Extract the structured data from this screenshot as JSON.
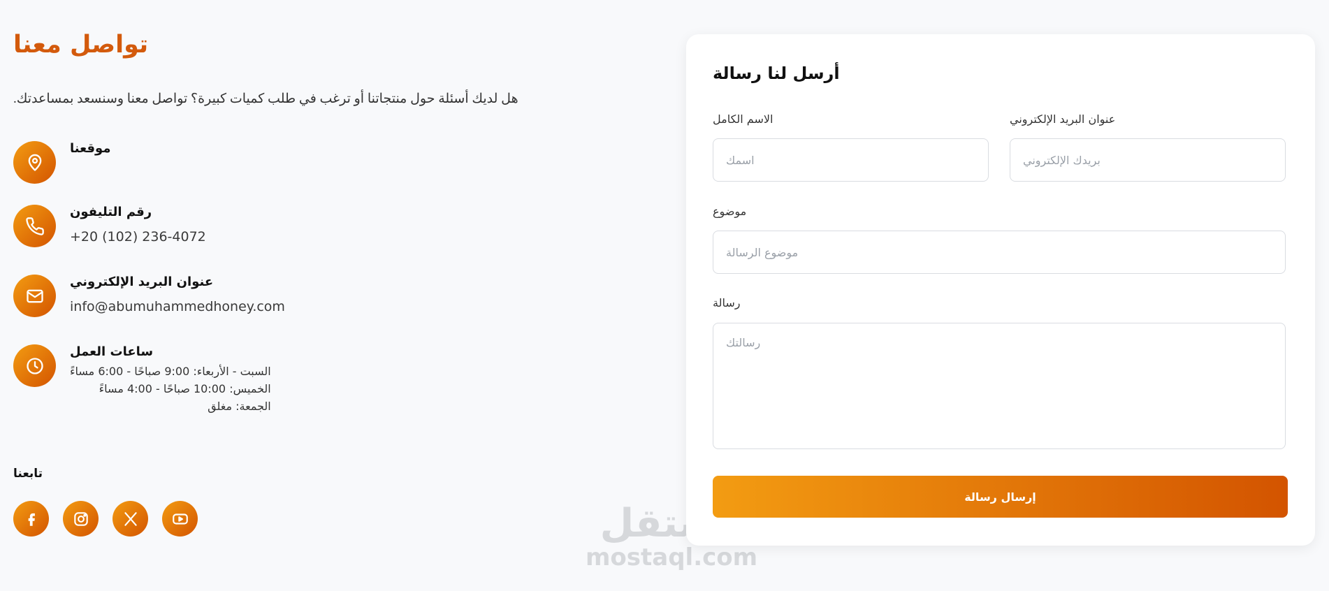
{
  "contact": {
    "title": "تواصل معنا",
    "intro": ".هل لديك أسئلة حول منتجاتنا أو ترغب في طلب كميات كبيرة؟ تواصل معنا وسنسعد بمساعدتك",
    "location": {
      "label": "موقعنا",
      "icon": "map-pin-icon"
    },
    "phone": {
      "label": "رقم التليفون",
      "value": "+20 (102) 236-4072",
      "icon": "phone-icon"
    },
    "email": {
      "label": "عنوان البريد الإلكتروني",
      "value": "info@abumuhammedhoney.com",
      "icon": "mail-icon"
    },
    "hours": {
      "label": "ساعات العمل",
      "icon": "clock-icon",
      "lines": [
        "السبت - الأربعاء: 9:00 صباحًا - 6:00 مساءً",
        "الخميس: 10:00 صباحًا - 4:00 مساءً",
        "الجمعة: مغلق"
      ]
    },
    "follow_label": "تابعنا",
    "socials": [
      "facebook-icon",
      "instagram-icon",
      "x-icon",
      "youtube-icon"
    ]
  },
  "form": {
    "title": "أرسل لنا رسالة",
    "name_label": "الاسم الكامل",
    "name_placeholder": "اسمك",
    "email_label": "عنوان البريد الإلكتروني",
    "email_placeholder": "بريدك الإلكتروني",
    "subject_label": "موضوع",
    "subject_placeholder": "موضوع الرسالة",
    "message_label": "رسالة",
    "message_placeholder": "رسالتك",
    "submit_label": "إرسال رسالة"
  },
  "watermark": {
    "arabic": "مستقل",
    "latin": "mostaql.com"
  },
  "colors": {
    "accent": "#d35a0c",
    "gradient_start": "#f39c12",
    "gradient_end": "#d35400"
  }
}
